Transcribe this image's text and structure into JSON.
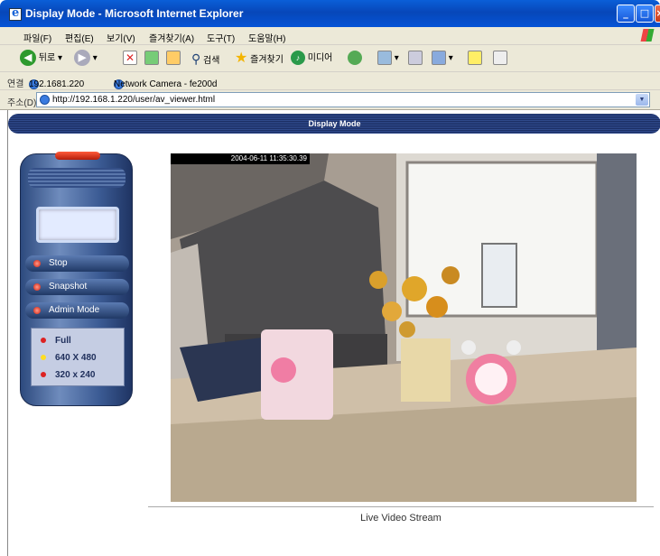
{
  "window": {
    "title": "Display Mode - Microsoft Internet Explorer"
  },
  "menu": [
    "파일(F)",
    "편집(E)",
    "보기(V)",
    "즐겨찾기(A)",
    "도구(T)",
    "도움말(H)"
  ],
  "toolbar": {
    "back": "뒤로",
    "search": "검색",
    "favorites": "즐겨찾기",
    "media": "미디어"
  },
  "links": {
    "label": "연결",
    "link1": "192.1681.220",
    "link2": "Network Camera - fe200d"
  },
  "address": {
    "label": "주소(D)",
    "url": "http://192.168.1.220/user/av_viewer.html"
  },
  "page": {
    "banner": "Display Mode",
    "controls": {
      "stop": "Stop",
      "snapshot": "Snapshot",
      "admin": "Admin Mode"
    },
    "resolutions": [
      "Full",
      "640 X 480",
      "320 x 240"
    ],
    "timestamp": "2004-06-11 11:35:30.39",
    "caption": "Live Video Stream"
  },
  "colors": {
    "accent": "#0a5fd8",
    "banner": "#2f4a8c",
    "panel": "#3c5c95"
  }
}
